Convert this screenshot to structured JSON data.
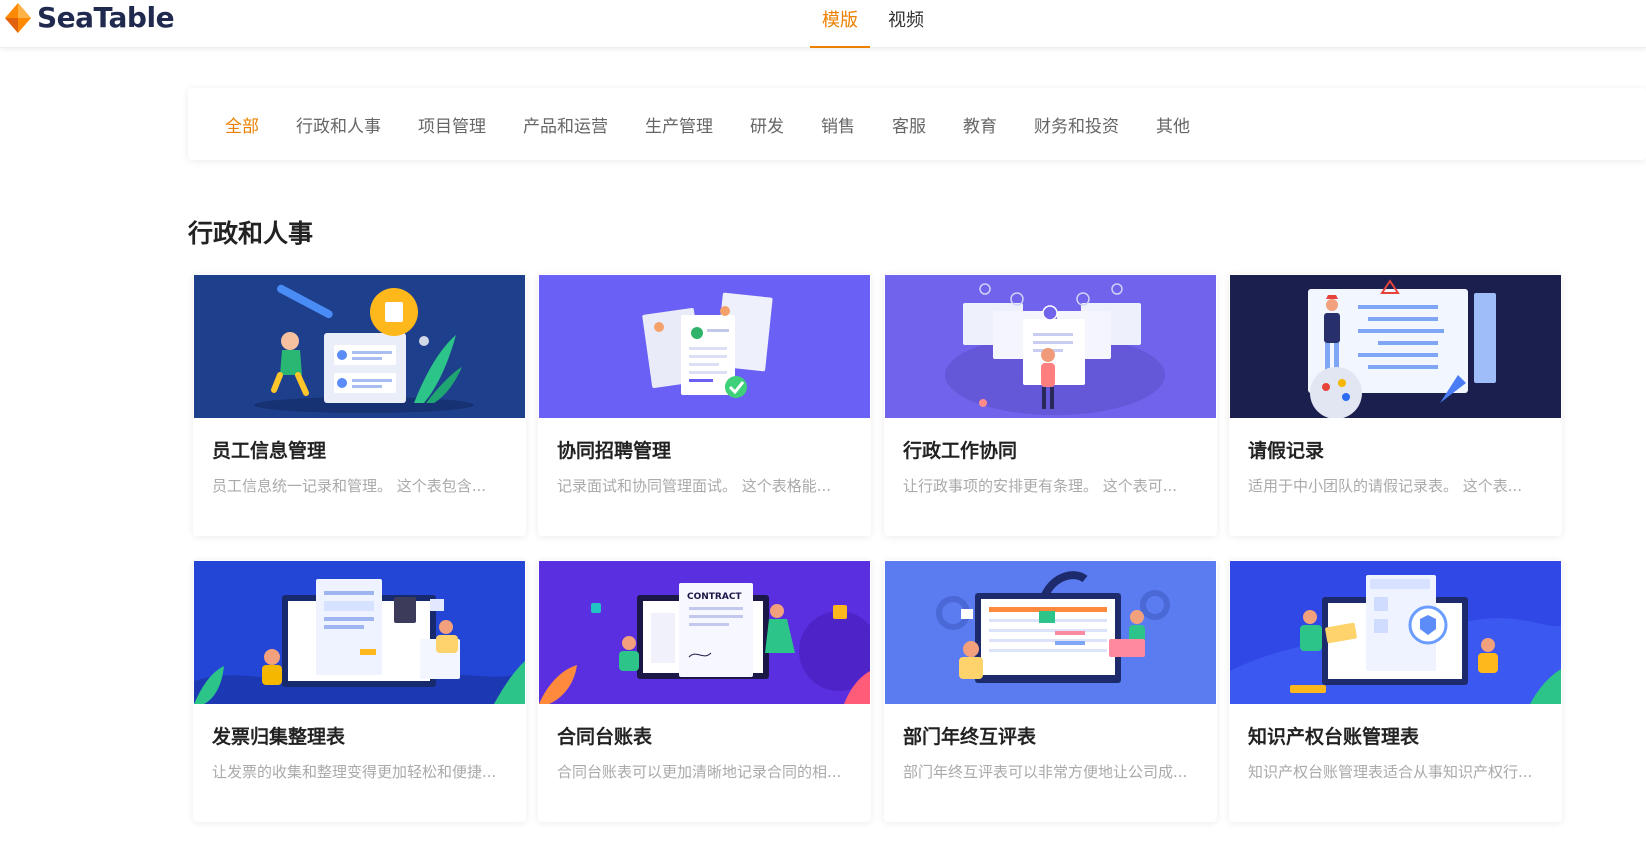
{
  "header": {
    "logo_text": "SeaTable",
    "tabs": [
      {
        "label": "模版",
        "active": true
      },
      {
        "label": "视频",
        "active": false
      }
    ]
  },
  "categories": [
    {
      "label": "全部",
      "active": true
    },
    {
      "label": "行政和人事"
    },
    {
      "label": "项目管理"
    },
    {
      "label": "产品和运营"
    },
    {
      "label": "生产管理"
    },
    {
      "label": "研发"
    },
    {
      "label": "销售"
    },
    {
      "label": "客服"
    },
    {
      "label": "教育"
    },
    {
      "label": "财务和投资"
    },
    {
      "label": "其他"
    }
  ],
  "section": {
    "title": "行政和人事"
  },
  "templates": [
    {
      "name": "员工信息管理",
      "desc": "员工信息统一记录和管理。 这个表包含...",
      "bg": "#1e3f8c"
    },
    {
      "name": "协同招聘管理",
      "desc": "记录面试和协同管理面试。 这个表格能...",
      "bg": "#6a60f5"
    },
    {
      "name": "行政工作协同",
      "desc": "让行政事项的安排更有条理。 这个表可...",
      "bg": "#7063ec"
    },
    {
      "name": "请假记录",
      "desc": "适用于中小团队的请假记录表。 这个表...",
      "bg": "#1a1f4d"
    },
    {
      "name": "发票归集整理表",
      "desc": "让发票的收集和整理变得更加轻松和便捷...",
      "bg": "#2446d6"
    },
    {
      "name": "合同台账表",
      "desc": "合同台账表可以更加清晰地记录合同的相...",
      "bg": "#5a2fe0"
    },
    {
      "name": "部门年终互评表",
      "desc": "部门年终互评表可以非常方便地让公司成...",
      "bg": "#5b7bf0"
    },
    {
      "name": "知识产权台账管理表",
      "desc": "知识产权台账管理表适合从事知识产权行...",
      "bg": "#3048e6"
    }
  ],
  "illustration_text": {
    "contract": "CONTRACT"
  },
  "colors": {
    "accent": "#ec8000",
    "brand_dark": "#1f2a4e"
  }
}
